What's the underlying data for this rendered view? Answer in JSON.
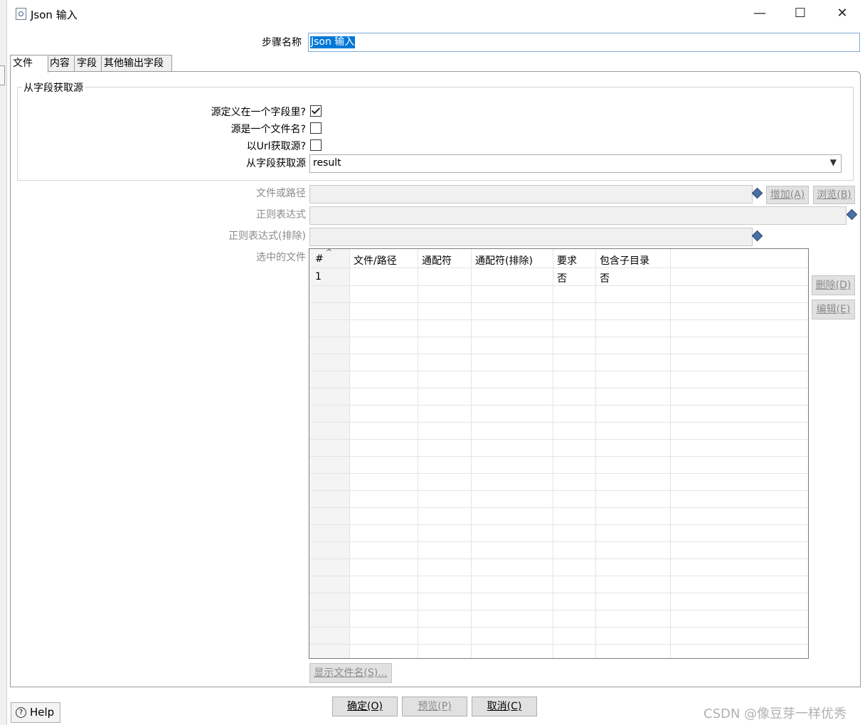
{
  "window": {
    "title": "Json 输入",
    "controls": {
      "minimize": "—",
      "maximize": "☐",
      "close": "✕"
    }
  },
  "step_name": {
    "label": "步骤名称",
    "value": "Json 输入"
  },
  "tabs": [
    {
      "label": "文件",
      "active": true
    },
    {
      "label": "内容",
      "active": false
    },
    {
      "label": "字段",
      "active": false
    },
    {
      "label": "其他输出字段",
      "active": false
    }
  ],
  "source_group": {
    "title": "从字段获取源",
    "source_in_field": {
      "label": "源定义在一个字段里?",
      "checked": true
    },
    "source_is_filename": {
      "label": "源是一个文件名?",
      "checked": false
    },
    "source_from_url": {
      "label": "以Url获取源?",
      "checked": false
    },
    "field_select": {
      "label": "从字段获取源",
      "value": "result"
    }
  },
  "file_or_dir": {
    "label": "文件或路径",
    "value": ""
  },
  "regex": {
    "label": "正则表达式",
    "value": ""
  },
  "regex_exclude": {
    "label": "正则表达式(排除)",
    "value": ""
  },
  "selected_files": {
    "label": "选中的文件",
    "columns": [
      "#",
      "文件/路径",
      "通配符",
      "通配符(排除)",
      "要求",
      "包含子目录"
    ],
    "rows": [
      {
        "index": "1",
        "path": "",
        "wildcard": "",
        "exclude_wildcard": "",
        "required": "否",
        "include_subfolders": "否"
      }
    ]
  },
  "buttons": {
    "add": "增加(A)",
    "browse": "浏览(B)",
    "delete": "删除(D)",
    "edit": "编辑(E)",
    "show_filenames": "显示文件名(S)...",
    "ok": "确定(O)",
    "preview": "预览(P)",
    "cancel": "取消(C)",
    "help": "Help"
  },
  "watermark": "CSDN @像豆芽一样优秀"
}
